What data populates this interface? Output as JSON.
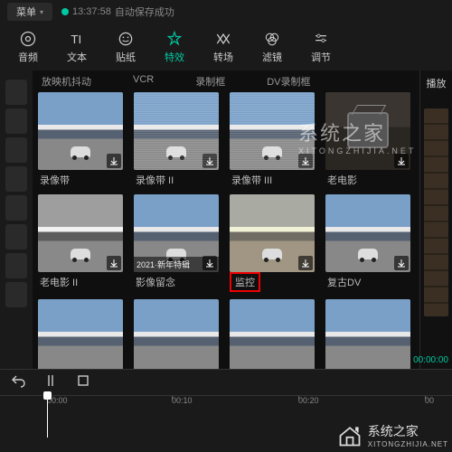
{
  "topbar": {
    "menu": "菜单",
    "time": "13:37:58",
    "save_status": "自动保存成功"
  },
  "toolbar": {
    "items": [
      {
        "id": "audio",
        "label": "音频"
      },
      {
        "id": "text",
        "label": "文本"
      },
      {
        "id": "sticker",
        "label": "贴纸"
      },
      {
        "id": "effect",
        "label": "特效",
        "active": true
      },
      {
        "id": "transition",
        "label": "转场"
      },
      {
        "id": "filter",
        "label": "滤镜"
      },
      {
        "id": "adjust",
        "label": "调节"
      }
    ]
  },
  "categories": [
    "放映机抖动",
    "VCR",
    "录制框",
    "DV录制框"
  ],
  "effects": {
    "row1": [
      {
        "label": "录像带",
        "variant": "clean"
      },
      {
        "label": "录像带 II",
        "variant": "noise"
      },
      {
        "label": "录像带 III",
        "variant": "noise"
      },
      {
        "label": "老电影",
        "variant": "tv"
      }
    ],
    "row2": [
      {
        "label": "老电影 II",
        "variant": "mono"
      },
      {
        "label": "影像留念",
        "variant": "vig",
        "badge": "2021·新年特辑"
      },
      {
        "label": "监控",
        "variant": "sepia",
        "highlight": true
      },
      {
        "label": "复古DV",
        "variant": "vig"
      }
    ]
  },
  "preview": {
    "title": "播放",
    "timestamp": "00:00:00"
  },
  "timeline": {
    "ticks": [
      "00:00",
      "00:10",
      "00:20",
      "00"
    ]
  },
  "watermark": {
    "brand": "系统之家",
    "sub": "XITONGZHIJIA.NET"
  }
}
